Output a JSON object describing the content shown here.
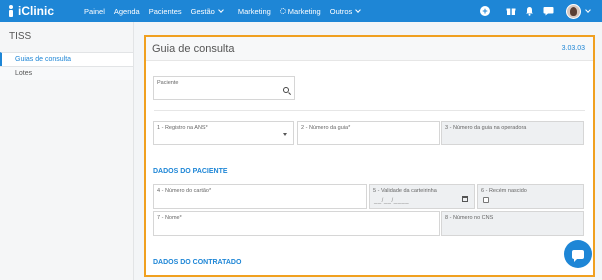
{
  "app": {
    "brand": "iClinic"
  },
  "nav": {
    "items": [
      {
        "label": "Painel"
      },
      {
        "label": "Agenda"
      },
      {
        "label": "Pacientes"
      },
      {
        "label": "Gestão"
      },
      {
        "label": "Marketing"
      },
      {
        "label": "Marketing"
      },
      {
        "label": "Outros"
      }
    ]
  },
  "sidebar": {
    "title": "TISS",
    "items": [
      {
        "label": "Guias de consulta",
        "active": true
      },
      {
        "label": "Lotes",
        "active": false
      }
    ]
  },
  "card": {
    "title": "Guia de consulta",
    "version": "3.03.03"
  },
  "fields": {
    "paciente": {
      "label": "Paciente",
      "value": ""
    },
    "registro_ans": {
      "label": "1 - Registro na ANS*",
      "value": ""
    },
    "numero_guia": {
      "label": "2 - Número da guia*",
      "value": ""
    },
    "numero_guia_operadora": {
      "label": "3 - Número da guia na operadora",
      "value": ""
    },
    "numero_cartao": {
      "label": "4 - Número do cartão*",
      "value": ""
    },
    "validade_carteirinha": {
      "label": "5 - Validade da carteirinha",
      "value": "__/__/____"
    },
    "recem_nascido": {
      "label": "6 - Recém nascido",
      "checked": false
    },
    "nome": {
      "label": "7 - Nome*",
      "value": ""
    },
    "numero_cns": {
      "label": "8 - Número no CNS",
      "value": ""
    }
  },
  "sections": {
    "dados_paciente": "DADOS DO PACIENTE",
    "dados_contratado": "DADOS DO CONTRATADO"
  },
  "colors": {
    "accent": "#1e86d6",
    "highlight_border": "#f0a020"
  }
}
